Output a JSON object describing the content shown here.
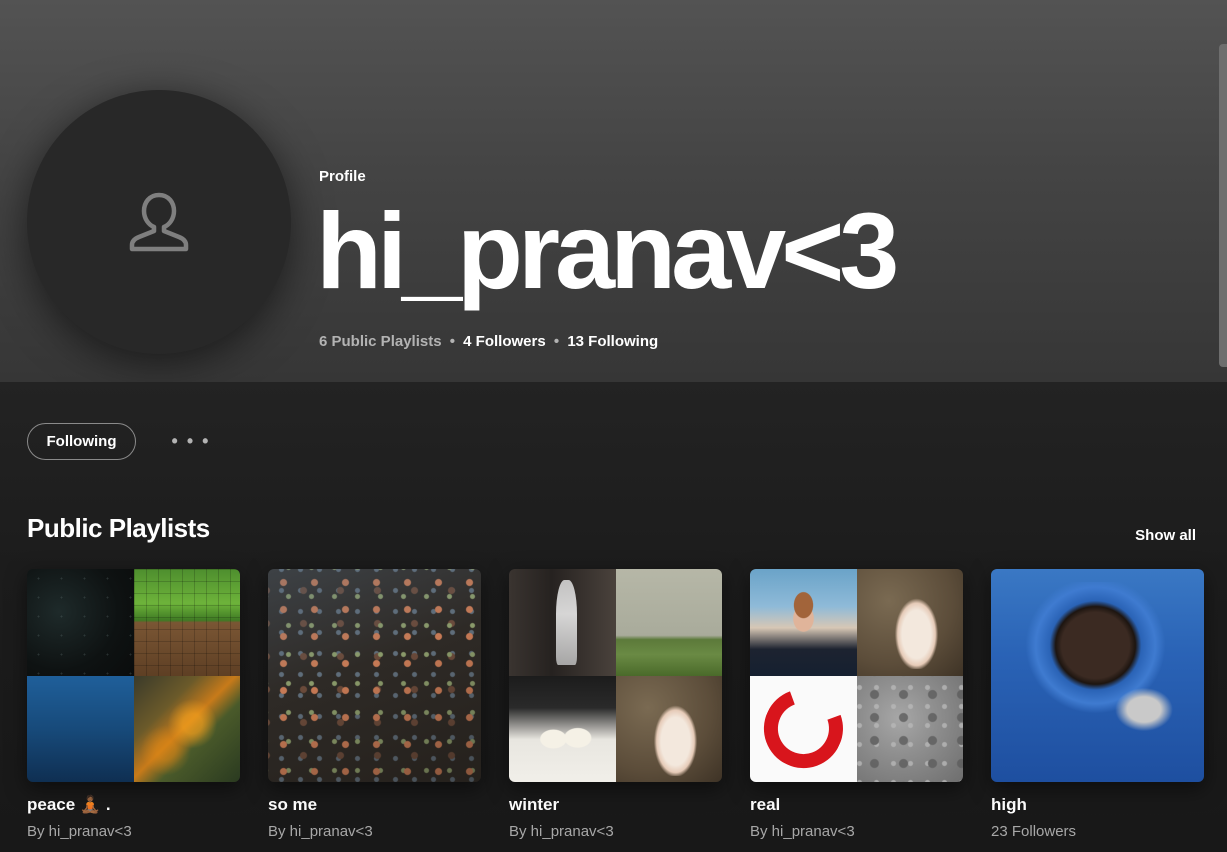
{
  "profile": {
    "label": "Profile",
    "name": "hi_pranav<3",
    "stats": {
      "playlists": "6 Public Playlists",
      "separator": "•",
      "followers": "4 Followers",
      "following": "13 Following"
    }
  },
  "actions": {
    "follow_label": "Following",
    "more_label": "• • •"
  },
  "section": {
    "title": "Public Playlists",
    "show_all": "Show all"
  },
  "playlists": [
    {
      "title": "peace 🧘🏾 .",
      "subtitle": "By hi_pranav<3"
    },
    {
      "title": "so me",
      "subtitle": "By hi_pranav<3"
    },
    {
      "title": "winter",
      "subtitle": "By hi_pranav<3"
    },
    {
      "title": "real",
      "subtitle": "By hi_pranav<3"
    },
    {
      "title": "high",
      "subtitle": "23 Followers"
    }
  ],
  "icons": {
    "avatar": "user-icon",
    "more": "more-options-icon"
  },
  "colors": {
    "header_top": "#535353",
    "header_bottom": "#363636",
    "background": "#1a1a1a",
    "text_primary": "#ffffff",
    "text_secondary": "#a7a7a7"
  }
}
